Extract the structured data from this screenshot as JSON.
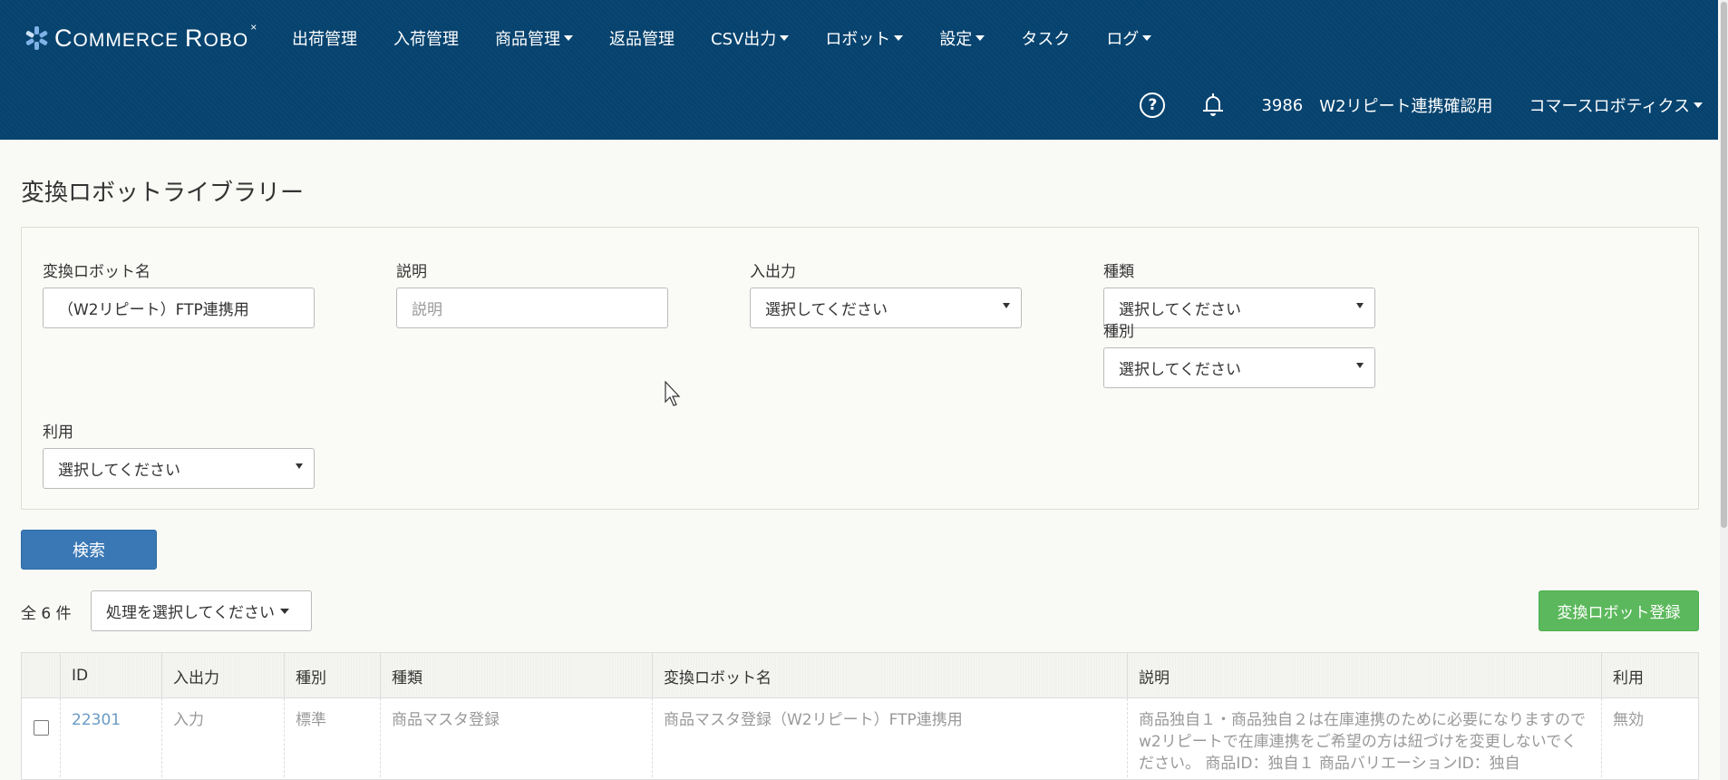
{
  "brand": {
    "name_c": "C",
    "name_rest1": "OMMERCE ",
    "name_r": "R",
    "name_rest2": "OBO",
    "mark": "×"
  },
  "nav": {
    "items": [
      {
        "label": "出荷管理",
        "dropdown": false
      },
      {
        "label": "入荷管理",
        "dropdown": false
      },
      {
        "label": "商品管理",
        "dropdown": true
      },
      {
        "label": "返品管理",
        "dropdown": false
      },
      {
        "label": "CSV出力",
        "dropdown": true
      },
      {
        "label": "ロボット",
        "dropdown": true
      },
      {
        "label": "設定",
        "dropdown": true
      },
      {
        "label": "タスク",
        "dropdown": false
      },
      {
        "label": "ログ",
        "dropdown": true
      }
    ],
    "shop_id": "3986",
    "shop_name": "W2リピート連携確認用",
    "company": "コマースロボティクス",
    "help_glyph": "?"
  },
  "page": {
    "title": "変換ロボットライブラリー"
  },
  "filters": {
    "robot_name": {
      "label": "変換ロボット名",
      "value": "（W2リピート）FTP連携用"
    },
    "description": {
      "label": "説明",
      "placeholder": "説明"
    },
    "io": {
      "label": "入出力",
      "value": "選択してください"
    },
    "kind": {
      "label": "種類",
      "value": "選択してください"
    },
    "category": {
      "label": "種別",
      "value": "選択してください"
    },
    "usage": {
      "label": "利用",
      "value": "選択してください"
    }
  },
  "search_button": "検索",
  "results": {
    "total": "全 6 件",
    "action_select": "処理を選択してください",
    "register_button": "変換ロボット登録"
  },
  "table": {
    "headers": [
      "ID",
      "入出力",
      "種別",
      "種類",
      "変換ロボット名",
      "説明",
      "利用"
    ],
    "rows": [
      {
        "id": "22301",
        "io": "入力",
        "category": "標準",
        "kind": "商品マスタ登録",
        "name": "商品マスタ登録（W2リピート）FTP連携用",
        "description": "商品独自１・商品独自２は在庫連携のために必要になりますので w2リピートで在庫連携をご希望の方は紐づけを変更しないでください。 商品ID：独自１ 商品バリエーションID：独自",
        "usage": "無効"
      }
    ]
  },
  "colors": {
    "navbar": "#05426e",
    "primary": "#3a78b5",
    "success": "#5cb85c",
    "link": "#6a9bc6"
  }
}
